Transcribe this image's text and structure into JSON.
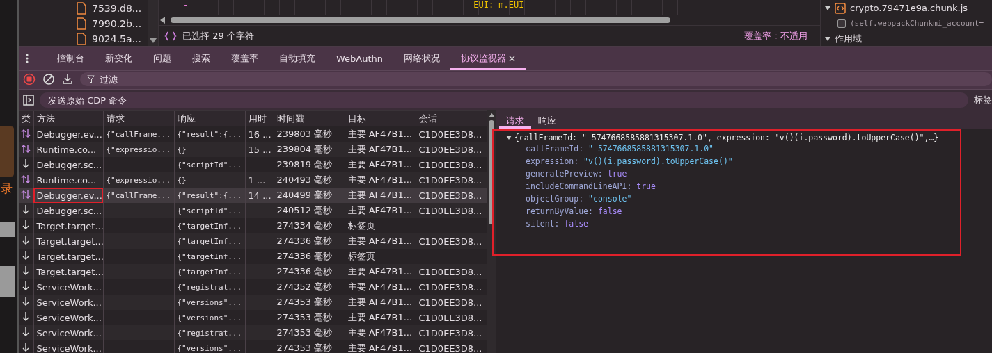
{
  "left_strip": {
    "text": "录"
  },
  "file_tree": {
    "items": [
      {
        "name": "7539.d8..."
      },
      {
        "name": "7990.2b..."
      },
      {
        "name": "9024.5a..."
      }
    ]
  },
  "editor": {
    "fragments": [
      {
        "kind": "plain",
        "text": "-"
      },
      {
        "kind": "code",
        "text": "EUI: m.EUI"
      }
    ],
    "selection": "已选择 29 个字符",
    "coverage": "覆盖率：不适用"
  },
  "scope_pane": {
    "file": {
      "name": "crypto.79471e9a.chunk.js",
      "expanded": true
    },
    "breakpoints": [
      {
        "text": "(self.webpackChunkmi_account=",
        "checked": false
      }
    ],
    "section": {
      "label": "作用域",
      "expanded": true
    }
  },
  "drawer": {
    "tabs": [
      {
        "label": "控制台",
        "selected": false
      },
      {
        "label": "新变化",
        "selected": false
      },
      {
        "label": "问题",
        "selected": false
      },
      {
        "label": "搜索",
        "selected": false
      },
      {
        "label": "覆盖率",
        "selected": false
      },
      {
        "label": "自动填充",
        "selected": false
      },
      {
        "label": "WebAuthn",
        "selected": false
      },
      {
        "label": "网络状况",
        "selected": false
      },
      {
        "label": "协议监视器",
        "selected": true,
        "closable": true
      }
    ],
    "filter": {
      "placeholder": "过滤"
    },
    "recording": true,
    "command": {
      "placeholder": "发送原始 CDP 命令"
    },
    "target_label": "标签"
  },
  "table": {
    "columns": [
      "类",
      "方法",
      "请求",
      "响应",
      "用时",
      "时间戳",
      "目标",
      "会话"
    ],
    "rows": [
      {
        "kind": "command",
        "method": "Debugger.ev...",
        "request": "{\"callFrame...",
        "response": "{\"result\":{...",
        "elapsed": "16 ...",
        "timestamp": "239803 毫秒",
        "target": "主要 AF47B1...",
        "session": "C1D0EE3D8...",
        "selected": false,
        "highlighted": false
      },
      {
        "kind": "command",
        "method": "Runtime.co...",
        "request": "{\"expressio...",
        "response": "{}",
        "elapsed": "15 ...",
        "timestamp": "239804 毫秒",
        "target": "主要 AF47B1...",
        "session": "C1D0EE3D8...",
        "selected": false,
        "highlighted": false
      },
      {
        "kind": "event",
        "method": "Debugger.sc...",
        "response": "{\"scriptId\"...",
        "timestamp": "239819 毫秒",
        "target": "主要 AF47B1...",
        "session": "C1D0EE3D8...",
        "selected": false,
        "highlighted": false
      },
      {
        "kind": "command",
        "method": "Runtime.co...",
        "request": "{\"expressio...",
        "response": "{}",
        "elapsed": "1 ...",
        "timestamp": "240493 毫秒",
        "target": "主要 AF47B1...",
        "session": "C1D0EE3D8...",
        "selected": false,
        "highlighted": false
      },
      {
        "kind": "command",
        "method": "Debugger.ev...",
        "request": "{\"callFrame...",
        "response": "{\"result\":{...",
        "elapsed": "14 ...",
        "timestamp": "240499 毫秒",
        "target": "主要 AF47B1...",
        "session": "C1D0EE3D8...",
        "selected": true,
        "highlighted": true
      },
      {
        "kind": "event",
        "method": "Debugger.sc...",
        "response": "{\"scriptId\"...",
        "timestamp": "240512 毫秒",
        "target": "主要 AF47B1...",
        "session": "C1D0EE3D8...",
        "selected": false,
        "highlighted": false
      },
      {
        "kind": "event",
        "method": "Target.target...",
        "response": "{\"targetInf...",
        "timestamp": "274334 毫秒",
        "target": "标签页",
        "selected": false,
        "highlighted": false
      },
      {
        "kind": "event",
        "method": "Target.target...",
        "response": "{\"targetInf...",
        "timestamp": "274336 毫秒",
        "target": "主要 AF47B1...",
        "session": "C1D0EE3D8...",
        "selected": false,
        "highlighted": false
      },
      {
        "kind": "event",
        "method": "Target.target...",
        "response": "{\"targetInf...",
        "timestamp": "274336 毫秒",
        "target": "标签页",
        "selected": false,
        "highlighted": false
      },
      {
        "kind": "event",
        "method": "Target.target...",
        "response": "{\"targetInf...",
        "timestamp": "274336 毫秒",
        "target": "主要 AF47B1...",
        "session": "C1D0EE3D8...",
        "selected": false,
        "highlighted": false
      },
      {
        "kind": "event",
        "method": "ServiceWork...",
        "response": "{\"registrat...",
        "timestamp": "274352 毫秒",
        "target": "主要 AF47B1...",
        "session": "C1D0EE3D8...",
        "selected": false,
        "highlighted": false
      },
      {
        "kind": "event",
        "method": "ServiceWork...",
        "response": "{\"versions\"...",
        "timestamp": "274353 毫秒",
        "target": "主要 AF47B1...",
        "session": "C1D0EE3D8...",
        "selected": false,
        "highlighted": false
      },
      {
        "kind": "event",
        "method": "ServiceWork...",
        "response": "{\"versions\"...",
        "timestamp": "274353 毫秒",
        "target": "主要 AF47B1...",
        "session": "C1D0EE3D8...",
        "selected": false,
        "highlighted": false
      },
      {
        "kind": "event",
        "method": "ServiceWork...",
        "response": "{\"registrat...",
        "timestamp": "274353 毫秒",
        "target": "主要 AF47B1...",
        "session": "C1D0EE3D8...",
        "selected": false,
        "highlighted": false
      },
      {
        "kind": "event",
        "method": "ServiceWork...",
        "response": "{\"versions\"...",
        "timestamp": "274353 毫秒",
        "target": "主要 AF47B1...",
        "session": "C1D0EE3D8...",
        "selected": false,
        "highlighted": false
      }
    ]
  },
  "detail": {
    "tabs": [
      {
        "label": "请求",
        "selected": true
      },
      {
        "label": "响应",
        "selected": false
      }
    ],
    "highlighted": true,
    "summary": {
      "text": "{callFrameId: \"-5747668585881315307.1.0\", expression: \"v()(i.password).toUpperCase()\",…}",
      "expanded": true
    },
    "properties": [
      {
        "key": "callFrameId:",
        "value": "\"-5747668585881315307.1.0\"",
        "kind": "string"
      },
      {
        "key": "expression:",
        "value": "\"v()(i.password).toUpperCase()\"",
        "kind": "string"
      },
      {
        "key": "generatePreview:",
        "value": "true",
        "kind": "boolean"
      },
      {
        "key": "includeCommandLineAPI:",
        "value": "true",
        "kind": "boolean"
      },
      {
        "key": "objectGroup:",
        "value": "\"console\"",
        "kind": "string"
      },
      {
        "key": "returnByValue:",
        "value": "false",
        "kind": "boolean"
      },
      {
        "key": "silent:",
        "value": "false",
        "kind": "boolean"
      }
    ]
  }
}
